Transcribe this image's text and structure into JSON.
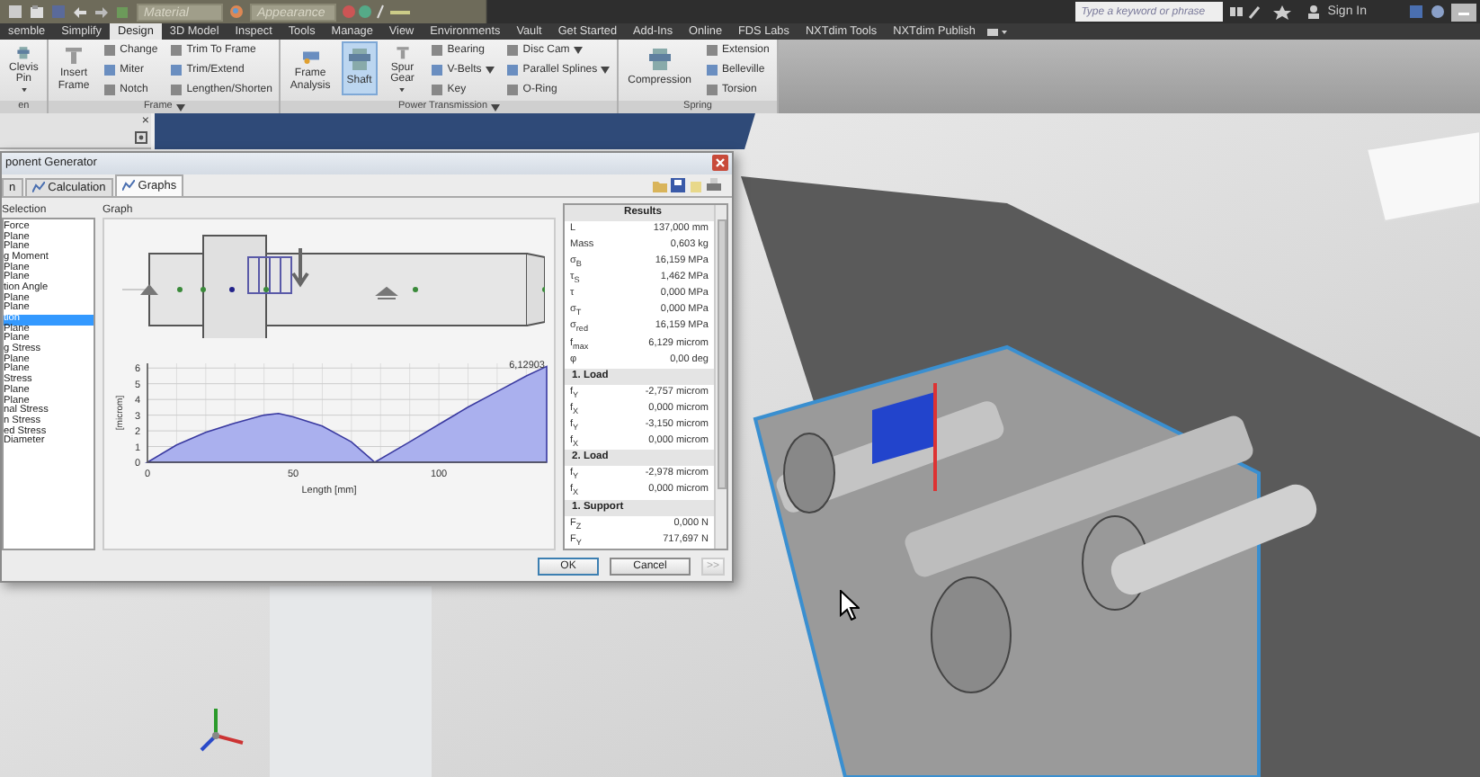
{
  "title_bar": {
    "material": "Material",
    "appearance": "Appearance",
    "search": {
      "placeholder": "Type a keyword or phrase"
    },
    "sign_in": "Sign In"
  },
  "ribbon": {
    "tabs": [
      {
        "label": "semble",
        "selected": false
      },
      {
        "label": "Simplify",
        "selected": false
      },
      {
        "label": "Design",
        "selected": true
      },
      {
        "label": "3D Model",
        "selected": false
      },
      {
        "label": "Inspect",
        "selected": false
      },
      {
        "label": "Tools",
        "selected": false
      },
      {
        "label": "Manage",
        "selected": false
      },
      {
        "label": "View",
        "selected": false
      },
      {
        "label": "Environments",
        "selected": false
      },
      {
        "label": "Vault",
        "selected": false
      },
      {
        "label": "Get Started",
        "selected": false
      },
      {
        "label": "Add-Ins",
        "selected": false
      },
      {
        "label": "Online",
        "selected": false
      },
      {
        "label": "FDS Labs",
        "selected": false
      },
      {
        "label": "NXTdim Tools",
        "selected": false
      },
      {
        "label": "NXTdim Publish",
        "selected": false
      }
    ],
    "groups": [
      {
        "label": "en",
        "menu": false,
        "columns": [
          [
            {
              "label": "Clevis Pin",
              "kind": "large",
              "menu": true,
              "selected": false
            }
          ]
        ]
      },
      {
        "label": "Frame",
        "menu": true,
        "columns": [
          [
            {
              "label": "Insert Frame",
              "kind": "large",
              "menu": false,
              "selected": false
            }
          ],
          [
            {
              "label": "Change",
              "kind": "small",
              "menu": false,
              "selected": false
            },
            {
              "label": "Miter",
              "kind": "small",
              "menu": false,
              "selected": false
            },
            {
              "label": "Notch",
              "kind": "small",
              "menu": false,
              "selected": false
            }
          ],
          [
            {
              "label": "Trim To Frame",
              "kind": "small",
              "menu": false,
              "selected": false
            },
            {
              "label": "Trim/Extend",
              "kind": "small",
              "menu": false,
              "selected": false
            },
            {
              "label": "Lengthen/Shorten",
              "kind": "small",
              "menu": false,
              "selected": false
            }
          ]
        ]
      },
      {
        "label": "Power Transmission",
        "menu": true,
        "columns": [
          [
            {
              "label": "Frame Analysis",
              "kind": "large",
              "menu": false,
              "selected": false
            }
          ],
          [
            {
              "label": "Shaft",
              "kind": "large",
              "menu": false,
              "selected": true
            }
          ],
          [
            {
              "label": "Spur Gear",
              "kind": "large",
              "menu": true,
              "selected": false
            }
          ],
          [
            {
              "label": "Bearing",
              "kind": "small",
              "menu": false,
              "selected": false
            },
            {
              "label": "V-Belts",
              "kind": "small",
              "menu": true,
              "selected": false
            },
            {
              "label": "Key",
              "kind": "small",
              "menu": false,
              "selected": false
            }
          ],
          [
            {
              "label": "Disc Cam",
              "kind": "small",
              "menu": true,
              "selected": false
            },
            {
              "label": "Parallel Splines",
              "kind": "small",
              "menu": true,
              "selected": false
            },
            {
              "label": "O-Ring",
              "kind": "small",
              "menu": false,
              "selected": false
            }
          ]
        ]
      },
      {
        "label": "Spring",
        "menu": false,
        "columns": [
          [
            {
              "label": "Compression",
              "kind": "large",
              "menu": false,
              "selected": false
            }
          ],
          [
            {
              "label": "Extension",
              "kind": "small",
              "menu": false,
              "selected": false
            },
            {
              "label": "Belleville",
              "kind": "small",
              "menu": false,
              "selected": false
            },
            {
              "label": "Torsion",
              "kind": "small",
              "menu": false,
              "selected": false
            }
          ]
        ]
      }
    ]
  },
  "browser_panel": {
    "close": "×"
  },
  "dialog": {
    "title": "ponent Generator",
    "tabs": [
      {
        "label": "n",
        "selected": false
      },
      {
        "label": "Calculation",
        "selected": false
      },
      {
        "label": "Graphs",
        "selected": true
      }
    ],
    "selection": {
      "label": "Selection",
      "items": [
        {
          "label": "Force",
          "selected": false
        },
        {
          "label": "Plane",
          "selected": false
        },
        {
          "label": "Plane",
          "selected": false
        },
        {
          "label": "g Moment",
          "selected": false
        },
        {
          "label": "Plane",
          "selected": false
        },
        {
          "label": "Plane",
          "selected": false
        },
        {
          "label": "tion Angle",
          "selected": false
        },
        {
          "label": "Plane",
          "selected": false
        },
        {
          "label": "Plane",
          "selected": false
        },
        {
          "label": "tion",
          "selected": true
        },
        {
          "label": "Plane",
          "selected": false
        },
        {
          "label": "Plane",
          "selected": false
        },
        {
          "label": "g Stress",
          "selected": false
        },
        {
          "label": "Plane",
          "selected": false
        },
        {
          "label": "Plane",
          "selected": false
        },
        {
          "label": "Stress",
          "selected": false
        },
        {
          "label": "Plane",
          "selected": false
        },
        {
          "label": "Plane",
          "selected": false
        },
        {
          "label": "nal Stress",
          "selected": false
        },
        {
          "label": "n Stress",
          "selected": false
        },
        {
          "label": "ed Stress",
          "selected": false
        },
        {
          "label": "Diameter",
          "selected": false
        }
      ]
    },
    "graph": {
      "label": "Graph",
      "chart_data": {
        "type": "area",
        "xlabel": "Length [mm]",
        "ylabel": "[microm]",
        "x": [
          0,
          10,
          20,
          30,
          40,
          45,
          50,
          60,
          70,
          78,
          90,
          100,
          110,
          120,
          130,
          137
        ],
        "series": [
          {
            "color": "#aab0ee",
            "values": [
              0,
              1.1,
              1.9,
              2.5,
              3.0,
              3.1,
              2.9,
              2.3,
              1.3,
              0,
              1.3,
              2.4,
              3.5,
              4.5,
              5.5,
              6.1
            ]
          }
        ],
        "grid": true,
        "xlim": [
          0,
          137
        ],
        "ylim": [
          0,
          6.3
        ],
        "xticks": [
          0,
          50,
          100
        ],
        "yticks": [
          0,
          1,
          2,
          3,
          4,
          5,
          6
        ],
        "annotations": [
          {
            "x": 137,
            "y": 6.1,
            "text": "6,12903"
          }
        ]
      }
    },
    "results": {
      "rows": [
        {
          "kind": "header",
          "label": "Results"
        },
        {
          "kind": "value",
          "symbol": "L",
          "value": "137,000 mm"
        },
        {
          "kind": "value",
          "symbol": "Mass",
          "value": "0,603 kg"
        },
        {
          "kind": "value",
          "symbol": "σ$_{B}$",
          "value": "16,159 MPa"
        },
        {
          "kind": "value",
          "symbol": "τ$_{S}$",
          "value": "1,462 MPa"
        },
        {
          "kind": "value",
          "symbol": "τ",
          "value": "0,000 MPa"
        },
        {
          "kind": "value",
          "symbol": "σ$_{T}$",
          "value": "0,000 MPa"
        },
        {
          "kind": "value",
          "symbol": "σ$_{red}$",
          "value": "16,159 MPa"
        },
        {
          "kind": "value",
          "symbol": "f$_{max}$",
          "value": "6,129 microm"
        },
        {
          "kind": "value",
          "symbol": "φ",
          "value": "0,00 deg"
        },
        {
          "kind": "header",
          "label": "1. Load"
        },
        {
          "kind": "value",
          "symbol": "f$_{Y}$",
          "value": "-2,757 microm"
        },
        {
          "kind": "value",
          "symbol": "f$_{X}$",
          "value": "0,000 microm"
        },
        {
          "kind": "value",
          "symbol": "f$_{Y}$",
          "value": "-3,150 microm"
        },
        {
          "kind": "value",
          "symbol": "f$_{X}$",
          "value": "0,000 microm"
        },
        {
          "kind": "header",
          "label": "2. Load"
        },
        {
          "kind": "value",
          "symbol": "f$_{Y}$",
          "value": "-2,978 microm"
        },
        {
          "kind": "value",
          "symbol": "f$_{X}$",
          "value": "0,000 microm"
        },
        {
          "kind": "header",
          "label": "1. Support"
        },
        {
          "kind": "value",
          "symbol": "F$_{Z}$",
          "value": "0,000 N"
        },
        {
          "kind": "value",
          "symbol": "F$_{Y}$",
          "value": "717,697 N"
        }
      ]
    },
    "buttons": [
      {
        "label": "OK",
        "kind": "default",
        "disabled": false
      },
      {
        "label": "Cancel",
        "kind": "normal",
        "disabled": false
      },
      {
        "label": ">>",
        "kind": "normal",
        "disabled": true
      }
    ]
  }
}
